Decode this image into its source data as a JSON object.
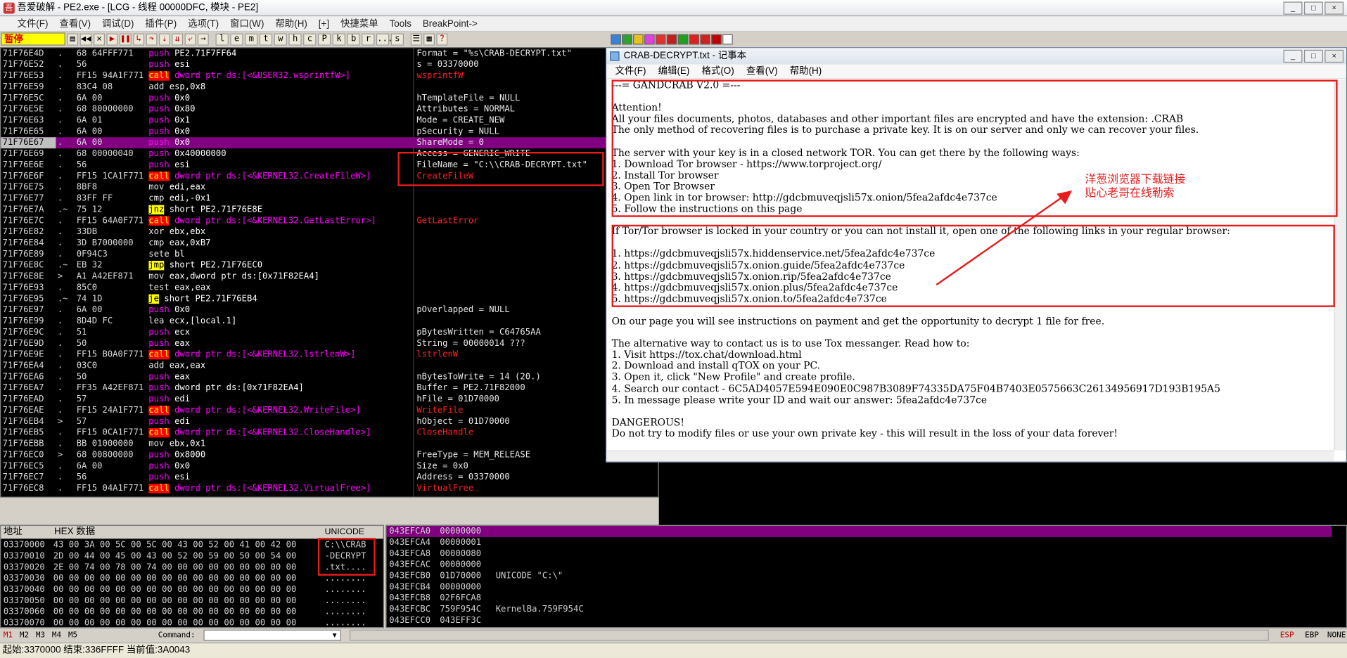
{
  "window": {
    "title": "吾爱破解 - PE2.exe - [LCG - 线程 00000DFC, 模块 - PE2]",
    "min_label": "_",
    "max_label": "□",
    "close_label": "×"
  },
  "menu": [
    "文件(F)",
    "查看(V)",
    "调试(D)",
    "插件(P)",
    "选项(T)",
    "窗口(W)",
    "帮助(H)",
    "[+]",
    "快捷菜单",
    "Tools",
    "BreakPoint->"
  ],
  "toolbar": {
    "status": "暂停",
    "letters": [
      "l",
      "e",
      "m",
      "t",
      "w",
      "h",
      "c",
      "P",
      "k",
      "b",
      "r",
      "...",
      "s"
    ]
  },
  "disasm": [
    {
      "addr": "71F76E4D",
      "mark": ".",
      "hex": "68 64FFF771",
      "mn": "push",
      "ops": "PE2.71F7FF64",
      "kind": "push",
      "cmt": "Format = \"%s\\CRAB-DECRYPT.txt\"",
      "sel": false,
      "hl": false
    },
    {
      "addr": "71F76E52",
      "mark": ".",
      "hex": "56",
      "mn": "push",
      "ops": "esi",
      "kind": "push",
      "cmt": "s = 03370000",
      "sel": false,
      "hl": false
    },
    {
      "addr": "71F76E53",
      "mark": ".",
      "hex": "FF15 94A1F771",
      "mn": "call",
      "ops": "dword ptr ds:[<&USER32.wsprintfW>]",
      "kind": "call",
      "cmt": "wsprintfW",
      "capi": true,
      "sel": false,
      "hl": false
    },
    {
      "addr": "71F76E59",
      "mark": ".",
      "hex": "83C4 08",
      "mn": "add",
      "ops": "esp,0x8",
      "kind": "plain",
      "cmt": "",
      "sel": false,
      "hl": false
    },
    {
      "addr": "71F76E5C",
      "mark": ".",
      "hex": "6A 00",
      "mn": "push",
      "ops": "0x0",
      "kind": "push",
      "cmt": "hTemplateFile = NULL",
      "sel": false,
      "hl": false
    },
    {
      "addr": "71F76E5E",
      "mark": ".",
      "hex": "68 80000000",
      "mn": "push",
      "ops": "0x80",
      "kind": "push",
      "cmt": "Attributes = NORMAL",
      "sel": false,
      "hl": false
    },
    {
      "addr": "71F76E63",
      "mark": ".",
      "hex": "6A 01",
      "mn": "push",
      "ops": "0x1",
      "kind": "push",
      "cmt": "Mode = CREATE_NEW",
      "sel": false,
      "hl": false
    },
    {
      "addr": "71F76E65",
      "mark": ".",
      "hex": "6A 00",
      "mn": "push",
      "ops": "0x0",
      "kind": "push",
      "cmt": "pSecurity = NULL",
      "sel": false,
      "hl": false
    },
    {
      "addr": "71F76E67",
      "mark": ".",
      "hex": "6A 00",
      "mn": "push",
      "ops": "0x0",
      "kind": "push",
      "cmt": "ShareMode = 0",
      "sel": true,
      "hl": true
    },
    {
      "addr": "71F76E69",
      "mark": ".",
      "hex": "68 00000040",
      "mn": "push",
      "ops": "0x40000000",
      "kind": "push",
      "cmt": "Access = GENERIC_WRITE",
      "sel": false,
      "hl": false
    },
    {
      "addr": "71F76E6E",
      "mark": ".",
      "hex": "56",
      "mn": "push",
      "ops": "esi",
      "kind": "push",
      "cmt": "FileName = \"C:\\\\CRAB-DECRYPT.txt\"",
      "sel": false,
      "hl": false
    },
    {
      "addr": "71F76E6F",
      "mark": ".",
      "hex": "FF15 1CA1F771",
      "mn": "call",
      "ops": "dword ptr ds:[<&KERNEL32.CreateFileW>]",
      "kind": "call",
      "cmt": "CreateFileW",
      "capi": true,
      "sel": false,
      "hl": false
    },
    {
      "addr": "71F76E75",
      "mark": ".",
      "hex": "8BF8",
      "mn": "mov",
      "ops": "edi,eax",
      "kind": "plain",
      "cmt": "",
      "sel": false,
      "hl": false
    },
    {
      "addr": "71F76E77",
      "mark": ".",
      "hex": "83FF FF",
      "mn": "cmp",
      "ops": "edi,-0x1",
      "kind": "plain",
      "cmt": "",
      "sel": false,
      "hl": false
    },
    {
      "addr": "71F76E7A",
      "mark": ".~",
      "hex": "75 12",
      "mn": "jnz",
      "ops": "short PE2.71F76E8E",
      "kind": "jmp",
      "cmt": "",
      "sel": false,
      "hl": false
    },
    {
      "addr": "71F76E7C",
      "mark": ".",
      "hex": "FF15 64A0F771",
      "mn": "call",
      "ops": "dword ptr ds:[<&KERNEL32.GetLastError>]",
      "kind": "call",
      "cmt": "GetLastError",
      "capi": true,
      "sel": false,
      "hl": false
    },
    {
      "addr": "71F76E82",
      "mark": ".",
      "hex": "33DB",
      "mn": "xor",
      "ops": "ebx,ebx",
      "kind": "plain",
      "cmt": "",
      "sel": false,
      "hl": false
    },
    {
      "addr": "71F76E84",
      "mark": ".",
      "hex": "3D B7000000",
      "mn": "cmp",
      "ops": "eax,0xB7",
      "kind": "plain",
      "cmt": "",
      "sel": false,
      "hl": false
    },
    {
      "addr": "71F76E89",
      "mark": ".",
      "hex": "0F94C3",
      "mn": "sete",
      "ops": "bl",
      "kind": "plain",
      "cmt": "",
      "sel": false,
      "hl": false
    },
    {
      "addr": "71F76E8C",
      "mark": ".~",
      "hex": "EB 32",
      "mn": "jmp",
      "ops": "short PE2.71F76EC0",
      "kind": "jmp",
      "cmt": "",
      "sel": false,
      "hl": false
    },
    {
      "addr": "71F76E8E",
      "mark": ">",
      "hex": "A1 A42EF871",
      "mn": "mov",
      "ops": "eax,dword ptr ds:[0x71F82EA4]",
      "kind": "plain",
      "cmt": "",
      "sel": false,
      "hl": false
    },
    {
      "addr": "71F76E93",
      "mark": ".",
      "hex": "85C0",
      "mn": "test",
      "ops": "eax,eax",
      "kind": "plain",
      "cmt": "",
      "sel": false,
      "hl": false
    },
    {
      "addr": "71F76E95",
      "mark": ".~",
      "hex": "74 1D",
      "mn": "je",
      "ops": "short PE2.71F76EB4",
      "kind": "jmp",
      "cmt": "",
      "sel": false,
      "hl": false
    },
    {
      "addr": "71F76E97",
      "mark": ".",
      "hex": "6A 00",
      "mn": "push",
      "ops": "0x0",
      "kind": "push",
      "cmt": "pOverlapped = NULL",
      "sel": false,
      "hl": false
    },
    {
      "addr": "71F76E99",
      "mark": ".",
      "hex": "8D4D FC",
      "mn": "lea",
      "ops": "ecx,[local.1]",
      "kind": "plain",
      "cmt": "",
      "sel": false,
      "hl": false
    },
    {
      "addr": "71F76E9C",
      "mark": ".",
      "hex": "51",
      "mn": "push",
      "ops": "ecx",
      "kind": "push",
      "cmt": "pBytesWritten = C64765AA",
      "sel": false,
      "hl": false
    },
    {
      "addr": "71F76E9D",
      "mark": ".",
      "hex": "50",
      "mn": "push",
      "ops": "eax",
      "kind": "push",
      "cmt": "String = 00000014 ???",
      "sel": false,
      "hl": false
    },
    {
      "addr": "71F76E9E",
      "mark": ".",
      "hex": "FF15 B0A0F771",
      "mn": "call",
      "ops": "dword ptr ds:[<&KERNEL32.lstrlenW>]",
      "kind": "call",
      "cmt": "lstrlenW",
      "capi": true,
      "sel": false,
      "hl": false
    },
    {
      "addr": "71F76EA4",
      "mark": ".",
      "hex": "03C0",
      "mn": "add",
      "ops": "eax,eax",
      "kind": "plain",
      "cmt": "",
      "sel": false,
      "hl": false
    },
    {
      "addr": "71F76EA6",
      "mark": ".",
      "hex": "50",
      "mn": "push",
      "ops": "eax",
      "kind": "push",
      "cmt": "nBytesToWrite = 14 (20.)",
      "sel": false,
      "hl": false
    },
    {
      "addr": "71F76EA7",
      "mark": ".",
      "hex": "FF35 A42EF871",
      "mn": "push",
      "ops": "dword ptr ds:[0x71F82EA4]",
      "kind": "push",
      "cmt": "Buffer = PE2.71F82000",
      "sel": false,
      "hl": false
    },
    {
      "addr": "71F76EAD",
      "mark": ".",
      "hex": "57",
      "mn": "push",
      "ops": "edi",
      "kind": "push",
      "cmt": "hFile = 01D70000",
      "sel": false,
      "hl": false
    },
    {
      "addr": "71F76EAE",
      "mark": ".",
      "hex": "FF15 24A1F771",
      "mn": "call",
      "ops": "dword ptr ds:[<&KERNEL32.WriteFile>]",
      "kind": "call",
      "cmt": "WriteFile",
      "capi": true,
      "sel": false,
      "hl": false
    },
    {
      "addr": "71F76EB4",
      "mark": ">",
      "hex": "57",
      "mn": "push",
      "ops": "edi",
      "kind": "push",
      "cmt": "hObject = 01D70000",
      "sel": false,
      "hl": false
    },
    {
      "addr": "71F76EB5",
      "mark": ".",
      "hex": "FF15 0CA1F771",
      "mn": "call",
      "ops": "dword ptr ds:[<&KERNEL32.CloseHandle>]",
      "kind": "call",
      "cmt": "CloseHandle",
      "capi": true,
      "sel": false,
      "hl": false
    },
    {
      "addr": "71F76EBB",
      "mark": ".",
      "hex": "BB 01000000",
      "mn": "mov",
      "ops": "ebx,0x1",
      "kind": "plain",
      "cmt": "",
      "sel": false,
      "hl": false
    },
    {
      "addr": "71F76EC0",
      "mark": ">",
      "hex": "68 00800000",
      "mn": "push",
      "ops": "0x8000",
      "kind": "push",
      "cmt": "FreeType = MEM_RELEASE",
      "sel": false,
      "hl": false
    },
    {
      "addr": "71F76EC5",
      "mark": ".",
      "hex": "6A 00",
      "mn": "push",
      "ops": "0x0",
      "kind": "push",
      "cmt": "Size = 0x0",
      "sel": false,
      "hl": false
    },
    {
      "addr": "71F76EC7",
      "mark": ".",
      "hex": "56",
      "mn": "push",
      "ops": "esi",
      "kind": "push",
      "cmt": "Address = 03370000",
      "sel": false,
      "hl": false
    },
    {
      "addr": "71F76EC8",
      "mark": ".",
      "hex": "FF15 04A1F771",
      "mn": "call",
      "ops": "dword ptr ds:[<&KERNEL32.VirtualFree>]",
      "kind": "call",
      "cmt": "VirtualFree",
      "capi": true,
      "sel": false,
      "hl": false
    }
  ],
  "dump": {
    "headers": [
      "地址",
      "HEX 数据",
      "UNICODE"
    ],
    "rows": [
      {
        "addr": "03370000",
        "hex": "43 00 3A 00 5C 00 5C 00 43 00 52 00 41 00 42 00",
        "uni": "C:\\\\CRAB"
      },
      {
        "addr": "03370010",
        "hex": "2D 00 44 00 45 00 43 00 52 00 59 00 50 00 54 00",
        "uni": "-DECRYPT"
      },
      {
        "addr": "03370020",
        "hex": "2E 00 74 00 78 00 74 00 00 00 00 00 00 00 00 00",
        "uni": ".txt...."
      },
      {
        "addr": "03370030",
        "hex": "00 00 00 00 00 00 00 00 00 00 00 00 00 00 00 00",
        "uni": "........"
      },
      {
        "addr": "03370040",
        "hex": "00 00 00 00 00 00 00 00 00 00 00 00 00 00 00 00",
        "uni": "........"
      },
      {
        "addr": "03370050",
        "hex": "00 00 00 00 00 00 00 00 00 00 00 00 00 00 00 00",
        "uni": "........"
      },
      {
        "addr": "03370060",
        "hex": "00 00 00 00 00 00 00 00 00 00 00 00 00 00 00 00",
        "uni": "........"
      },
      {
        "addr": "03370070",
        "hex": "00 00 00 00 00 00 00 00 00 00 00 00 00 00 00 00",
        "uni": "........"
      }
    ]
  },
  "stack": [
    {
      "addr": "043EFCA0",
      "val": "00000000",
      "cmt": ""
    },
    {
      "addr": "043EFCA4",
      "val": "00000001",
      "cmt": ""
    },
    {
      "addr": "043EFCA8",
      "val": "00000080",
      "cmt": ""
    },
    {
      "addr": "043EFCAC",
      "val": "00000000",
      "cmt": ""
    },
    {
      "addr": "043EFCB0",
      "val": "01D70000",
      "cmt": "UNICODE \"C:\\\""
    },
    {
      "addr": "043EFCB4",
      "val": "00000000",
      "cmt": ""
    },
    {
      "addr": "043EFCB8",
      "val": "02F6FCA8",
      "cmt": ""
    },
    {
      "addr": "043EFCBC",
      "val": "759F954C",
      "cmt": "KernelBa.759F954C"
    },
    {
      "addr": "043EFCC0",
      "val": "043EFF3C",
      "cmt": ""
    }
  ],
  "bottom": {
    "tabs": [
      "M1",
      "M2",
      "M3",
      "M4",
      "M5"
    ],
    "command_label": "Command:",
    "regs": [
      "ESP",
      "EBP",
      "NONE"
    ]
  },
  "status": "起始:3370000 结束:336FFFF 当前值:3A0043",
  "notepad": {
    "title": "CRAB-DECRYPT.txt - 记事本",
    "menu": [
      "文件(F)",
      "编辑(E)",
      "格式(O)",
      "查看(V)",
      "帮助(H)"
    ],
    "lines": [
      "---= GANDCRAB V2.0 =---",
      "",
      "Attention!",
      "All your files documents, photos, databases and other important files are encrypted and have the extension: .CRAB",
      "The only method of recovering files is to purchase a private key. It is on our server and only we can recover your files.",
      "",
      "The server with your key is in a closed network TOR. You can get there by the following ways:",
      "1. Download Tor browser - https://www.torproject.org/",
      "2. Install Tor browser",
      "3. Open Tor Browser",
      "4. Open link in tor browser: http://gdcbmuveqjsli57x.onion/5fea2afdc4e737ce",
      "5. Follow the instructions on this page",
      "",
      "If Tor/Tor browser is locked in your country or you can not install it, open one of the following links in your regular browser:",
      "",
      "1. https://gdcbmuveqjsli57x.hiddenservice.net/5fea2afdc4e737ce",
      "2. https://gdcbmuveqjsli57x.onion.guide/5fea2afdc4e737ce",
      "3. https://gdcbmuveqjsli57x.onion.rip/5fea2afdc4e737ce",
      "4. https://gdcbmuveqjsli57x.onion.plus/5fea2afdc4e737ce",
      "5. https://gdcbmuveqjsli57x.onion.to/5fea2afdc4e737ce",
      "",
      "On our page you will see instructions on payment and get the opportunity to decrypt 1 file for free.",
      "",
      "The alternative way to contact us is to use Tox messanger. Read how to:",
      "1. Visit https://tox.chat/download.html",
      "2. Download and install qTOX on your PC.",
      "3. Open it, click \"New Profile\" and create profile.",
      "4. Search our contact - 6C5AD4057E594E090E0C987B3089F74335DA75F04B7403E0575663C26134956917D193B195A5",
      "5. In message please write your ID and wait our answer: 5fea2afdc4e737ce",
      "",
      "DANGEROUS!",
      "Do not try to modify files or use your own private key - this will result in the loss of your data forever!"
    ]
  },
  "annotation": "洋葱浏览器下载链接\n贴心老哥在线勒索",
  "colors": {
    "highlight": "#800080",
    "call": "#ff0000",
    "annot": "#e81c1c"
  }
}
